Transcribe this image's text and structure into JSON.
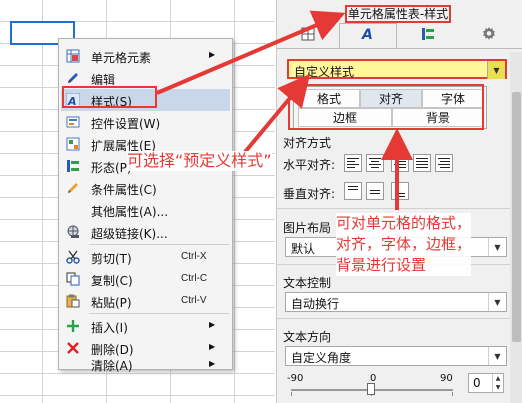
{
  "context_menu": {
    "items": [
      {
        "label": "单元格元素",
        "icon": "cell-element-icon",
        "shortcut": "",
        "submenu": true
      },
      {
        "label": "编辑",
        "icon": "pencil-icon",
        "shortcut": "",
        "submenu": false
      },
      {
        "label": "样式(S)",
        "icon": "style-icon",
        "shortcut": "",
        "submenu": false
      },
      {
        "label": "控件设置(W)",
        "icon": "widget-settings-icon",
        "shortcut": "",
        "submenu": false
      },
      {
        "label": "扩展属性(E)",
        "icon": "extended-attributes-icon",
        "shortcut": "",
        "submenu": false
      },
      {
        "label": "形态(P)",
        "icon": "form-icon",
        "shortcut": "",
        "submenu": false
      },
      {
        "label": "条件属性(C)",
        "icon": "condition-pencil-icon",
        "shortcut": "",
        "submenu": false
      },
      {
        "label": "其他属性(A)...",
        "icon": "",
        "shortcut": "",
        "submenu": false
      },
      {
        "label": "超级链接(K)...",
        "icon": "hyperlink-globe-icon",
        "shortcut": "",
        "submenu": false
      },
      {
        "label": "剪切(T)",
        "icon": "scissors-icon",
        "shortcut": "Ctrl-X",
        "submenu": false
      },
      {
        "label": "复制(C)",
        "icon": "copy-icon",
        "shortcut": "Ctrl-C",
        "submenu": false
      },
      {
        "label": "粘贴(P)",
        "icon": "paste-icon",
        "shortcut": "Ctrl-V",
        "submenu": false
      },
      {
        "label": "插入(I)",
        "icon": "plus-icon",
        "shortcut": "",
        "submenu": true
      },
      {
        "label": "删除(D)",
        "icon": "delete-x-icon",
        "shortcut": "",
        "submenu": true
      },
      {
        "label": "清除(A)",
        "icon": "",
        "shortcut": "",
        "submenu": true
      }
    ]
  },
  "panel": {
    "title": "单元格属性表-样式",
    "tabs": [
      {
        "icon": "cell-border-icon"
      },
      {
        "icon": "style-a-icon",
        "active": true
      },
      {
        "icon": "form-icon"
      },
      {
        "icon": "gear-icon"
      }
    ],
    "style_select": {
      "value": "自定义样式"
    },
    "format_buttons": [
      "格式",
      "对齐",
      "字体",
      "边框",
      "背景"
    ],
    "active_format": "对齐",
    "alignment": {
      "label": "对齐方式",
      "horizontal_label": "水平对齐:",
      "vertical_label": "垂直对齐:"
    },
    "image_layout": {
      "label": "图片布局",
      "value": "默认"
    },
    "text_control": {
      "label": "文本控制",
      "value": "自动换行"
    },
    "text_direction": {
      "label": "文本方向",
      "value": "自定义角度"
    },
    "rotation": {
      "min": "-90",
      "mid": "0",
      "max": "90",
      "value": "0"
    }
  },
  "annotations": {
    "left": "可选择“预定义样式”",
    "right": [
      "可对单元格的格式，",
      "对齐，字体，边框，",
      "背景进行设置"
    ]
  },
  "colors": {
    "annotation": "#e53935",
    "selection": "#1f6fd0",
    "menu_highlight": "#c9d7ea",
    "style_select_bg": "#fff79a"
  }
}
